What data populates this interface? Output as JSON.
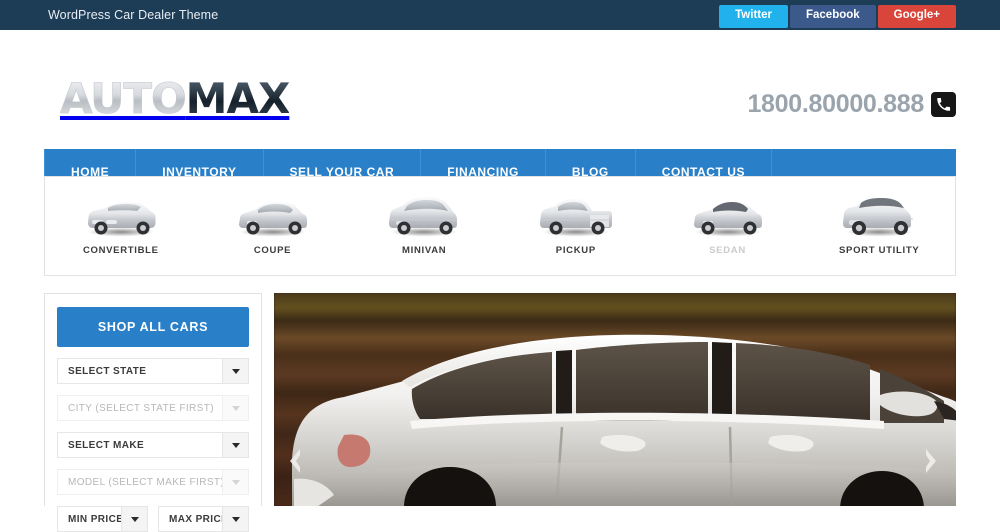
{
  "topbar": {
    "title": "WordPress Car Dealer Theme",
    "social": [
      {
        "label": "Twitter",
        "color": "#21b2ee"
      },
      {
        "label": "Facebook",
        "color": "#3b5a8b"
      },
      {
        "label": "Google+",
        "color": "#d9453a"
      }
    ]
  },
  "header": {
    "logo_light": "AUTO",
    "logo_dark": "MAX",
    "phone": "1800.80000.888",
    "phone_icon": "phone-icon"
  },
  "nav": {
    "items": [
      {
        "label": "HOME"
      },
      {
        "label": "INVENTORY"
      },
      {
        "label": "SELL YOUR CAR"
      },
      {
        "label": "FINANCING"
      },
      {
        "label": "BLOG"
      },
      {
        "label": "CONTACT US"
      }
    ]
  },
  "categories": [
    {
      "label": "CONVERTIBLE",
      "icon": "car-convertible-icon",
      "dim": false
    },
    {
      "label": "COUPE",
      "icon": "car-coupe-icon",
      "dim": false
    },
    {
      "label": "MINIVAN",
      "icon": "car-minivan-icon",
      "dim": false
    },
    {
      "label": "PICKUP",
      "icon": "car-pickup-icon",
      "dim": false
    },
    {
      "label": "SEDAN",
      "icon": "car-sedan-icon",
      "dim": true
    },
    {
      "label": "SPORT UTILITY",
      "icon": "car-suv-icon",
      "dim": false
    }
  ],
  "sidebar": {
    "shop_all_label": "SHOP ALL CARS",
    "fields": [
      {
        "label": "SELECT STATE",
        "disabled": false
      },
      {
        "label": "CITY (SELECT STATE FIRST)",
        "disabled": true
      },
      {
        "label": "SELECT MAKE",
        "disabled": false
      },
      {
        "label": "MODEL (SELECT MAKE FIRST)",
        "disabled": true
      }
    ],
    "price_fields": [
      {
        "label": "MIN PRICE",
        "disabled": false
      },
      {
        "label": "MAX PRICE",
        "disabled": false
      }
    ]
  },
  "hero": {
    "prev_icon": "chevron-left-icon",
    "next_icon": "chevron-right-icon",
    "alt": "silver-suv-photo"
  },
  "colors": {
    "topbar": "#1d3c56",
    "accent_blue": "#2980c9",
    "logo_dark": "#14202b",
    "phone_text": "#9aa4ad"
  }
}
